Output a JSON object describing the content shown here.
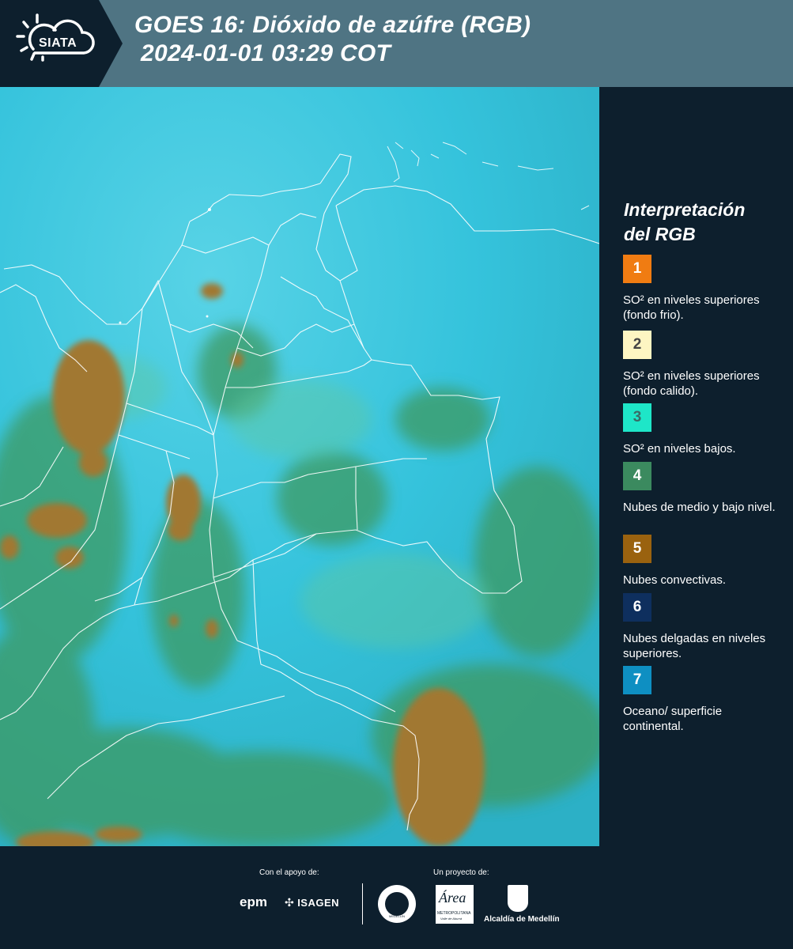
{
  "header": {
    "logo_text": "SIATA",
    "title_line1": "GOES 16: Dióxido de azúfre (RGB)",
    "title_line2": "2024-01-01 03:29 COT"
  },
  "legend": {
    "title_line1": "Interpretación",
    "title_line2": "del RGB",
    "items": [
      {
        "number": "1",
        "text": "SO² en niveles superiores (fondo frio).",
        "color": "#f07c12",
        "num_color": "#ffffff"
      },
      {
        "number": "2",
        "text": "SO² en niveles superiores (fondo calido).",
        "color": "#fdf5c2",
        "num_color": "#444444"
      },
      {
        "number": "3",
        "text": "SO² en niveles bajos.",
        "color": "#1ee6c8",
        "num_color": "#3a6a66"
      },
      {
        "number": "4",
        "text": "Nubes de medio y bajo nivel.",
        "color": "#3b8a5f",
        "num_color": "#ffffff"
      },
      {
        "number": "5",
        "text": "Nubes convectivas.",
        "color": "#9a620f",
        "num_color": "#ffffff"
      },
      {
        "number": "6",
        "text": "Nubes delgadas en niveles superiores.",
        "color": "#0e2f5e",
        "num_color": "#ffffff"
      },
      {
        "number": "7",
        "text": "Oceano/ superficie continental.",
        "color": "#0e8fc2",
        "num_color": "#ffffff"
      }
    ]
  },
  "footer": {
    "support_label": "Con el apoyo de:",
    "project_label": "Un proyecto de:",
    "logo_epm": "epm",
    "logo_isagen": "ISAGEN",
    "logo_metro_name": "Área",
    "logo_metro_sub1": "METROPOLITANA",
    "logo_metro_sub2": "Valle de Aburrá",
    "logo_alcaldia": "Alcaldía de Medellín",
    "logo_seal_text": "MEDELLÍN"
  },
  "colors": {
    "header_bg": "#4f7483",
    "logo_bg": "#0d1f2d",
    "page_bg": "#0d1f2d",
    "map_sky": "#3cc6dc",
    "map_cloud_brown": "#a37a2e",
    "map_green": "#3a9a5a"
  }
}
